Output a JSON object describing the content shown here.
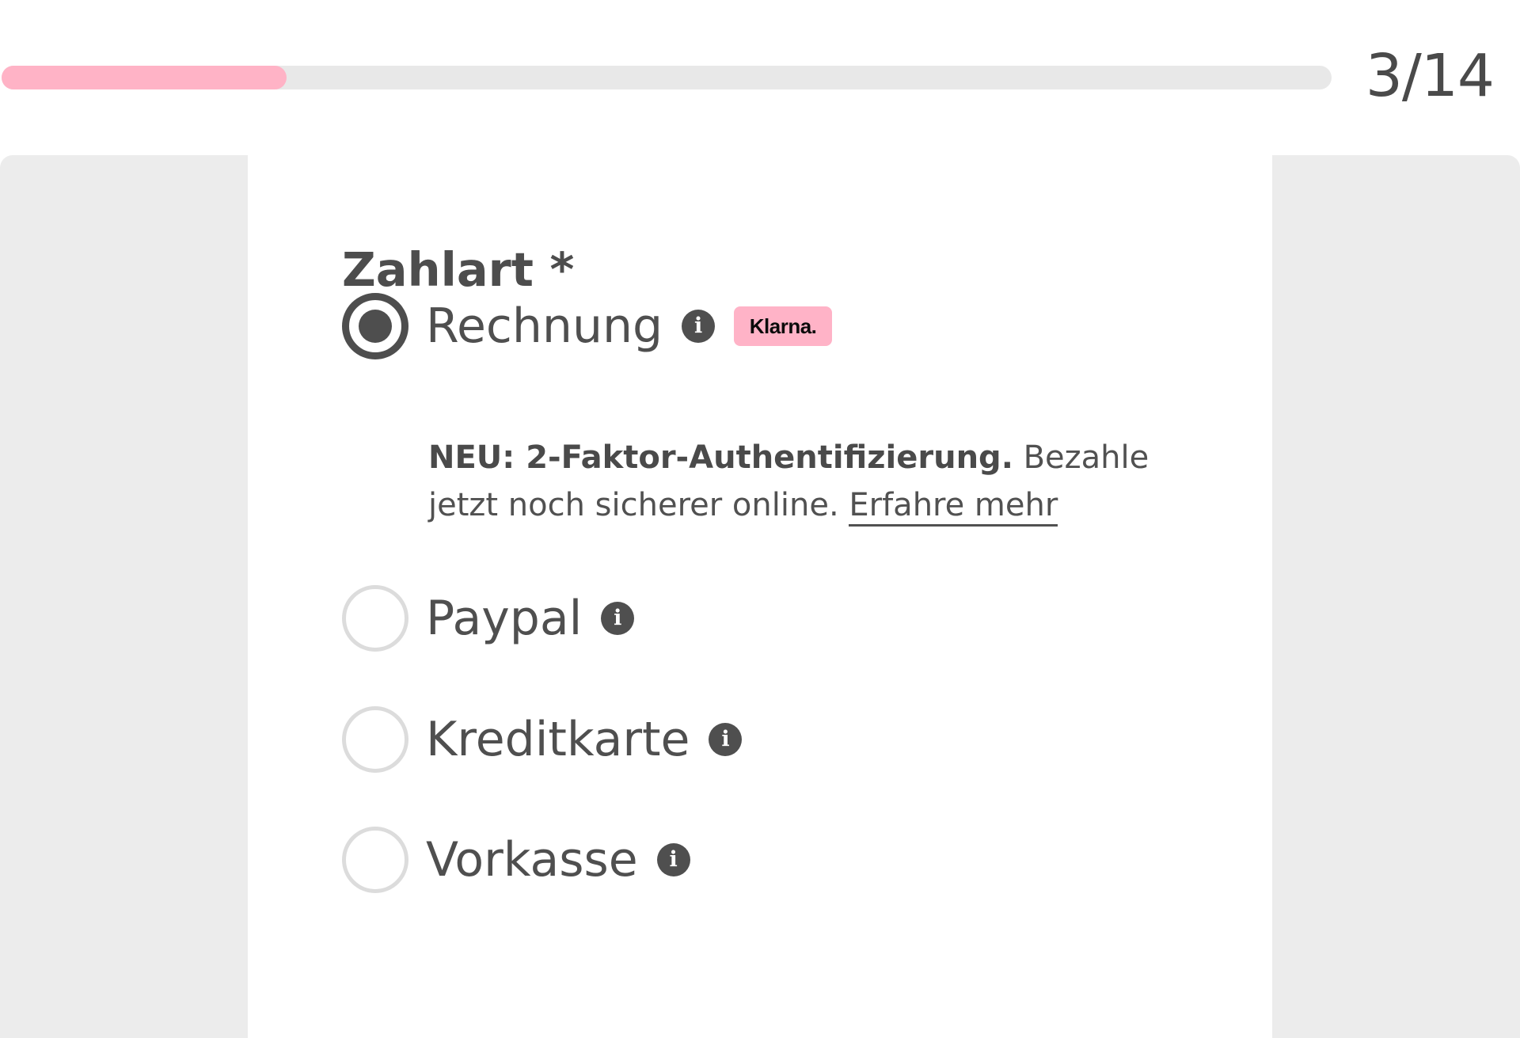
{
  "progress": {
    "current": 3,
    "total": 14,
    "fraction": 0.214,
    "label": "3/14",
    "color": "#ffb3c6"
  },
  "form": {
    "field_label": "Zahlart *",
    "options": [
      {
        "label": "Rechnung",
        "selected": true,
        "info_icon": "info-icon",
        "badge": "Klarna.",
        "description_bold": "NEU: 2-Faktor-Authentifizierung.",
        "description_text": " Bezahle jetzt noch sicherer online. ",
        "learn_more": "Erfahre mehr"
      },
      {
        "label": "Paypal",
        "selected": false,
        "info_icon": "info-icon"
      },
      {
        "label": "Kreditkarte",
        "selected": false,
        "info_icon": "info-icon"
      },
      {
        "label": "Vorkasse",
        "selected": false,
        "info_icon": "info-icon"
      }
    ]
  },
  "colors": {
    "accent_pink": "#ffb3c6",
    "klarna_pink": "#ffb3c7",
    "text": "#4f4f4f",
    "page_bg": "#ececec"
  }
}
